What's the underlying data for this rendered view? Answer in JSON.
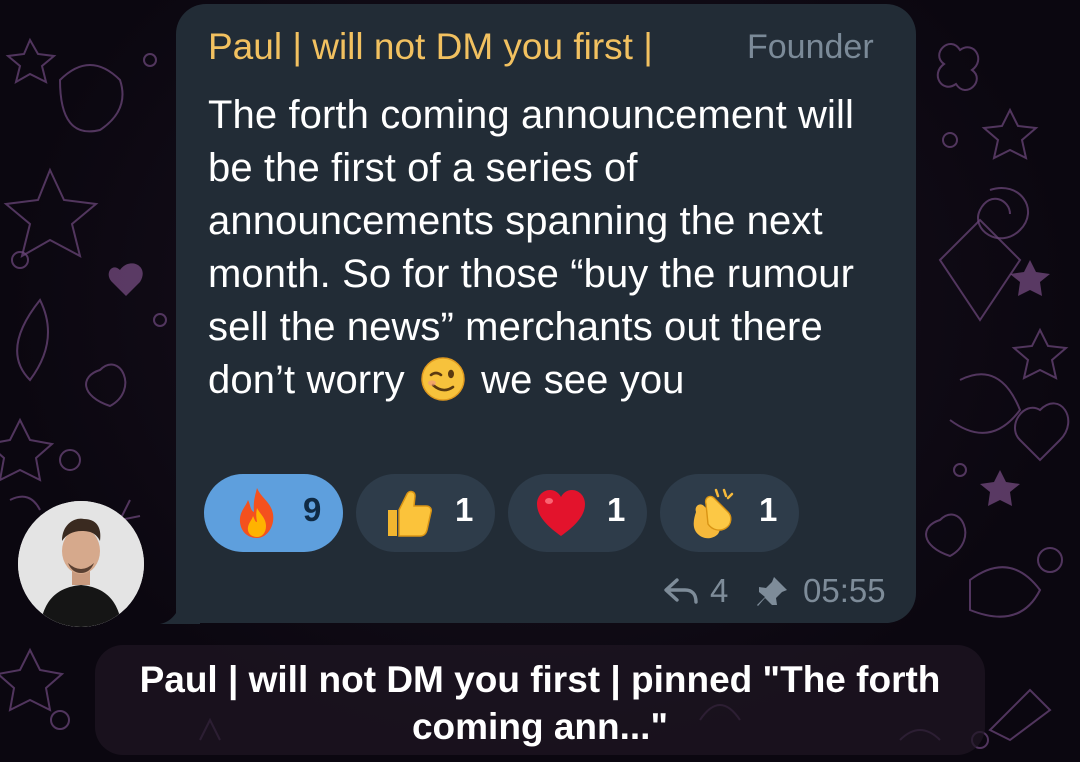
{
  "message": {
    "sender_name": "Paul | will not DM you first |",
    "sender_role": "Founder",
    "text_before_emoji": "The forth coming announcement will be the first of a series of announcements spanning the next month. So for those “buy the rumour sell the news” merchants out there don’t worry",
    "inline_emoji": "winking-face",
    "text_after_emoji": "we see you",
    "reactions": [
      {
        "emoji": "fire",
        "count": "9",
        "active": true
      },
      {
        "emoji": "thumbs-up",
        "count": "1",
        "active": false
      },
      {
        "emoji": "red-heart",
        "count": "1",
        "active": false
      },
      {
        "emoji": "clapping-hands",
        "count": "1",
        "active": false
      }
    ],
    "reply_count": "4",
    "time": "05:55",
    "pinned": true
  },
  "service_message": {
    "text": "Paul | will not DM you first | pinned \"The forth coming ann...\""
  },
  "colors": {
    "sender_name": "#f2c160",
    "bubble": "#222c36",
    "active_reaction": "#5e9fdd",
    "meta_text": "#7e8c99"
  }
}
